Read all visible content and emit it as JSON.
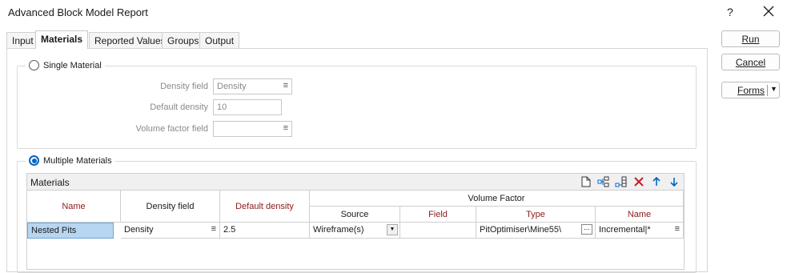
{
  "window": {
    "title": "Advanced Block Model Report",
    "help": "?",
    "close_icon": "close-icon"
  },
  "tabs": [
    {
      "label": "Input"
    },
    {
      "label": "Materials"
    },
    {
      "label": "Reported Values"
    },
    {
      "label": "Groups"
    },
    {
      "label": "Output"
    }
  ],
  "active_tab": "Materials",
  "single_material": {
    "label": "Single Material",
    "selected": false,
    "density_field_label": "Density field",
    "density_field_value": "Density",
    "default_density_label": "Default density",
    "default_density_value": "10",
    "volume_factor_label": "Volume factor field",
    "volume_factor_value": ""
  },
  "multiple_materials": {
    "label": "Multiple Materials",
    "selected": true
  },
  "materials_table": {
    "title": "Materials",
    "toolbar_icons": [
      "new-file-icon",
      "insert-rows-icon",
      "add-rows-icon",
      "delete-icon",
      "move-up-icon",
      "move-down-icon"
    ],
    "columns": {
      "name": "Name",
      "density_field": "Density field",
      "default_density": "Default density",
      "volume_factor": "Volume Factor",
      "source": "Source",
      "field": "Field",
      "type": "Type",
      "vf_name": "Name"
    },
    "rows": [
      {
        "name": "Nested Pits",
        "density_field": "Density",
        "default_density": "2.5",
        "source": "Wireframe(s)",
        "field": "",
        "type": "PitOptimiser\\Mine55\\",
        "vf_name": "Incremental|*"
      }
    ]
  },
  "buttons": {
    "run": "Run",
    "cancel": "Cancel",
    "forms": "Forms"
  },
  "colors": {
    "accent": "#0067c0",
    "required_header": "#8b1a1a",
    "selection": "#b7d6f2"
  }
}
